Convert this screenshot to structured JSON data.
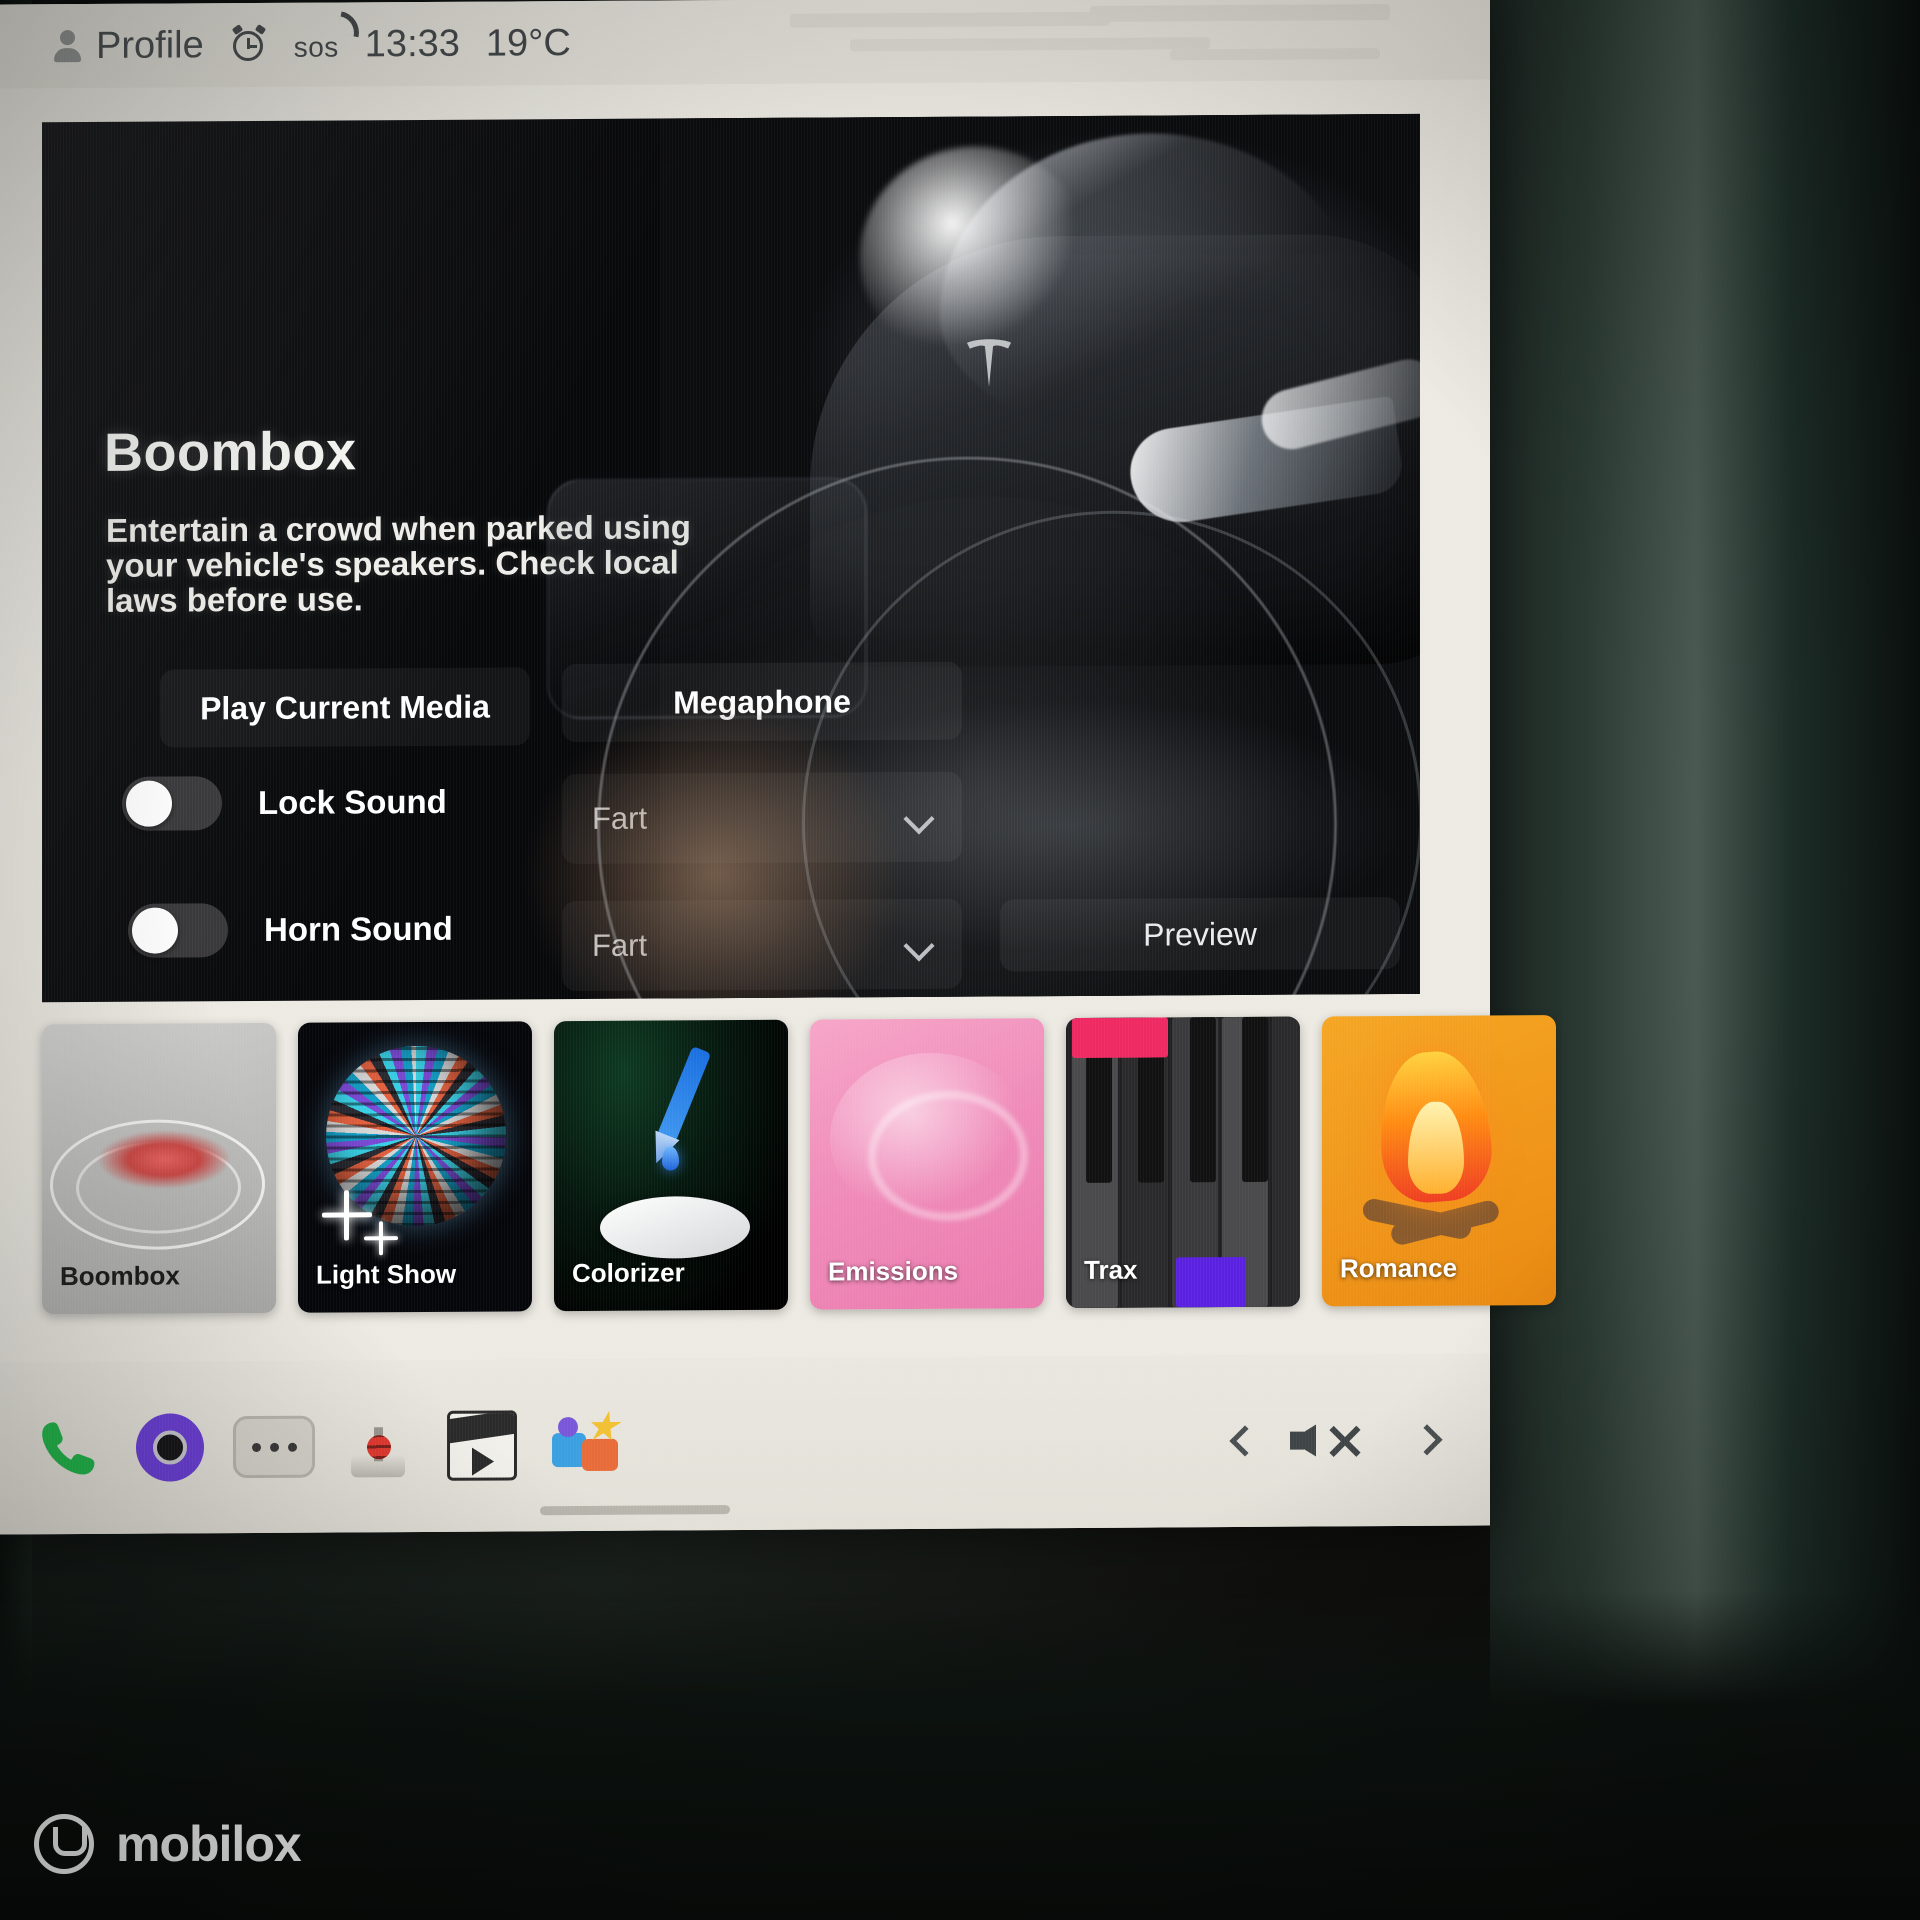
{
  "statusbar": {
    "profile_label": "Profile",
    "profile_icon": "person-icon",
    "alarm_icon": "alarm-clock-icon",
    "sos_label": "sos",
    "time": "13:33",
    "temperature": "19°C"
  },
  "app": {
    "title": "Boombox",
    "description": "Entertain a crowd when parked using your vehicle's speakers. Check local laws before use.",
    "buttons": {
      "play_current_media": "Play Current Media",
      "megaphone": "Megaphone",
      "preview": "Preview"
    },
    "toggles": [
      {
        "label": "Lock Sound",
        "state": "off"
      },
      {
        "label": "Horn Sound",
        "state": "off"
      }
    ],
    "selects": [
      {
        "name": "lock-sound-select",
        "value": "Fart",
        "chevron": "chevron-down-icon"
      },
      {
        "name": "horn-sound-select",
        "value": "Fart",
        "chevron": "chevron-down-icon"
      }
    ]
  },
  "drawer": {
    "tiles": [
      {
        "label": "Boombox",
        "key": "boombox",
        "selected": true
      },
      {
        "label": "Light Show",
        "key": "lightshow",
        "selected": false
      },
      {
        "label": "Colorizer",
        "key": "colorizer",
        "selected": false
      },
      {
        "label": "Emissions",
        "key": "emissions",
        "selected": false
      },
      {
        "label": "Trax",
        "key": "trax",
        "selected": false
      },
      {
        "label": "Romance",
        "key": "romance",
        "selected": false
      }
    ]
  },
  "taskbar": {
    "icons": [
      "phone-icon",
      "camera-icon",
      "more-dots-icon",
      "joystick-icon",
      "clapperboard-icon",
      "toybox-icon"
    ],
    "prev_icon": "chevron-left-icon",
    "mute_icon": "volume-mute-icon",
    "next_icon": "chevron-right-icon"
  },
  "watermark": {
    "text": "mobilox",
    "logo": "mobilox-logo-icon"
  },
  "colors": {
    "screen_bg": "#eceae2",
    "panel_bg": "#07080a",
    "accent_green": "#21b64a",
    "tile_pink": "#f08cba",
    "tile_orange": "#f0961a",
    "trax_pink": "#ef2a63",
    "trax_purple": "#5b21e0"
  }
}
